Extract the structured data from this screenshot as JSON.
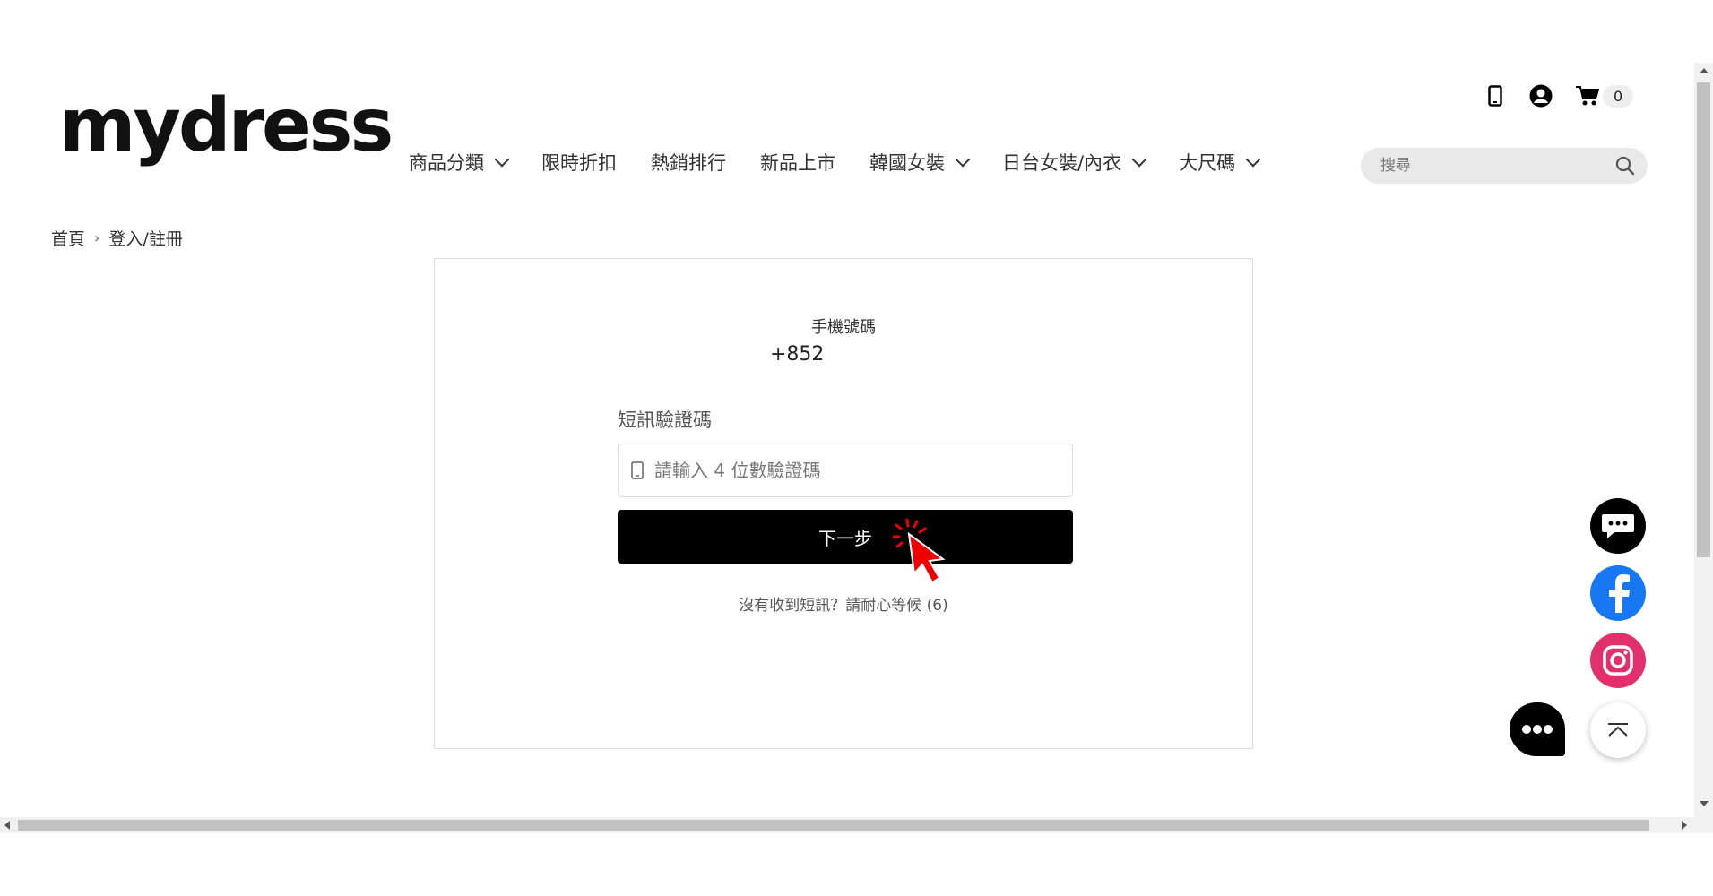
{
  "header": {
    "logo": "mydress",
    "nav": [
      {
        "label": "商品分類",
        "has_dropdown": true
      },
      {
        "label": "限時折扣",
        "has_dropdown": false
      },
      {
        "label": "熱銷排行",
        "has_dropdown": false
      },
      {
        "label": "新品上市",
        "has_dropdown": false
      },
      {
        "label": "韓國女裝",
        "has_dropdown": true
      },
      {
        "label": "日台女裝/內衣",
        "has_dropdown": true
      },
      {
        "label": "大尺碼",
        "has_dropdown": true
      }
    ],
    "cart_count": "0",
    "search_placeholder": "搜尋"
  },
  "breadcrumb": {
    "home": "首頁",
    "current": "登入/註冊"
  },
  "form": {
    "phone_label": "手機號碼",
    "phone_value": "+852",
    "sms_label": "短訊驗證碼",
    "sms_placeholder": "請輸入 4 位數驗證碼",
    "next_button": "下一步",
    "resend_text": "沒有收到短訊？請耐心等候 (6)"
  },
  "colors": {
    "facebook": "#1877f2",
    "instagram": "#e1306c",
    "button": "#000000"
  }
}
